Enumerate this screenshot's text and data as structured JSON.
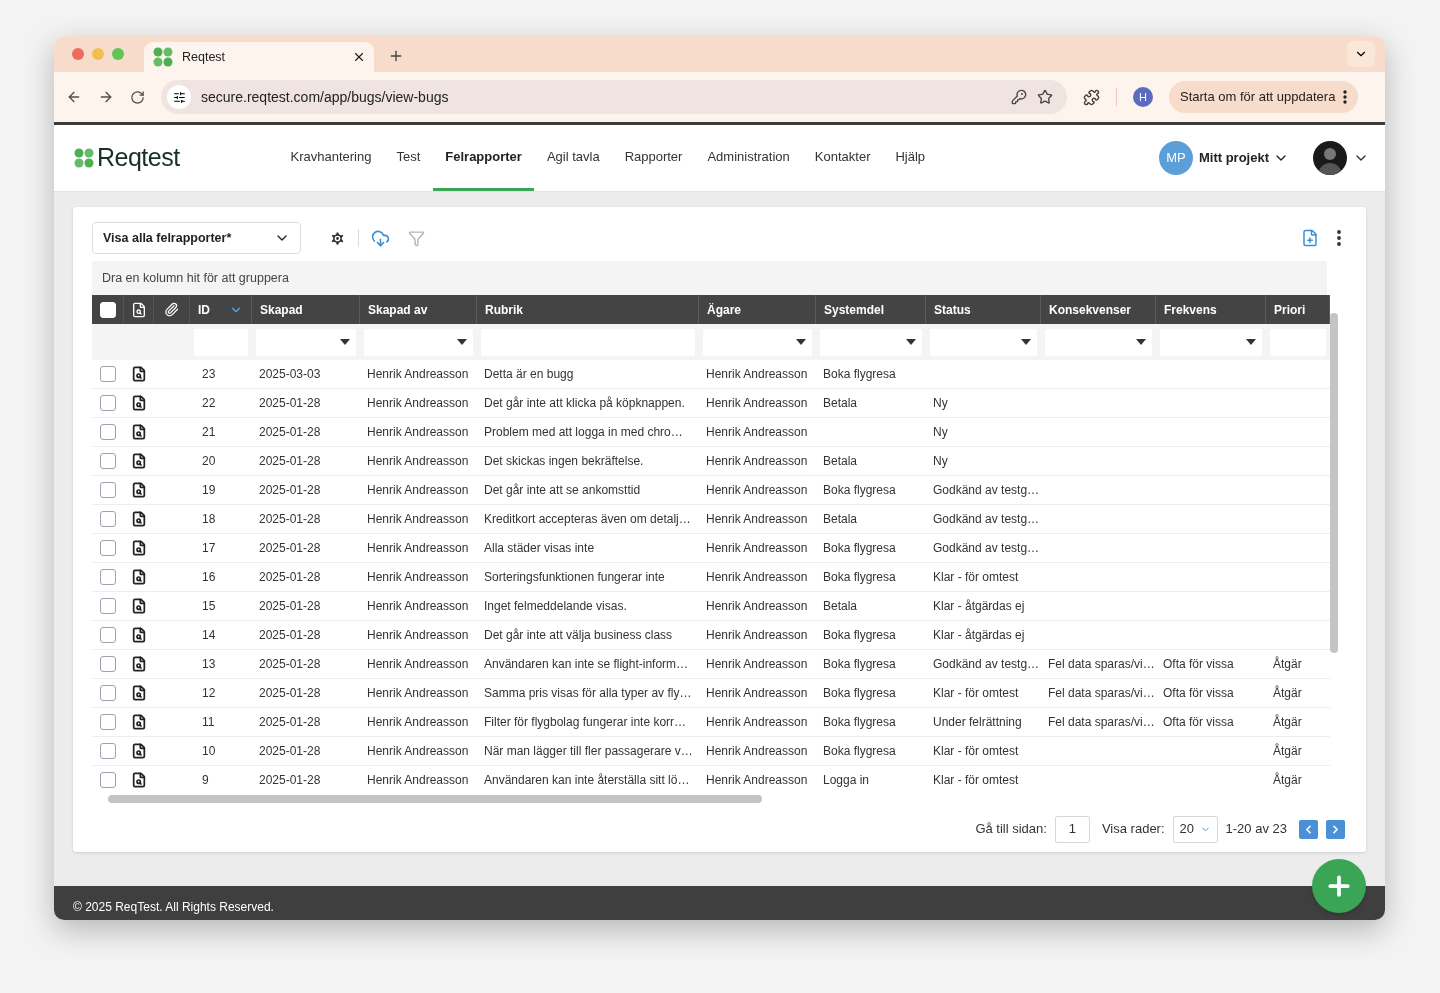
{
  "browser": {
    "tab_title": "Reqtest",
    "url": "secure.reqtest.com/app/bugs/view-bugs",
    "profile_initial": "H",
    "update_button": "Starta om för att uppdatera"
  },
  "app": {
    "logo": "Reqtest",
    "nav": [
      {
        "label": "Kravhantering",
        "selected": false
      },
      {
        "label": "Test",
        "selected": false
      },
      {
        "label": "Felrapporter",
        "selected": true
      },
      {
        "label": "Agil tavla",
        "selected": false
      },
      {
        "label": "Rapporter",
        "selected": false
      },
      {
        "label": "Administration",
        "selected": false
      },
      {
        "label": "Kontakter",
        "selected": false
      },
      {
        "label": "Hjälp",
        "selected": false
      }
    ],
    "project": {
      "initials": "MP",
      "name": "Mitt projekt"
    }
  },
  "toolbar": {
    "view_select": "Visa alla felrapporter*"
  },
  "group_hint": "Dra en kolumn hit för att gruppera",
  "table": {
    "select_all": {
      "checked": false
    },
    "columns": [
      {
        "label": "ID",
        "kind": "text",
        "sorted": true
      },
      {
        "label": "Skapad",
        "kind": "select",
        "sorted": false
      },
      {
        "label": "Skapad av",
        "kind": "select",
        "sorted": false
      },
      {
        "label": "Rubrik",
        "kind": "text",
        "sorted": false
      },
      {
        "label": "Ägare",
        "kind": "select",
        "sorted": false
      },
      {
        "label": "Systemdel",
        "kind": "select",
        "sorted": false
      },
      {
        "label": "Status",
        "kind": "select",
        "sorted": false
      },
      {
        "label": "Konsekvenser",
        "kind": "select",
        "sorted": false
      },
      {
        "label": "Frekvens",
        "kind": "select",
        "sorted": false
      },
      {
        "label": "Priori",
        "kind": "text",
        "sorted": false
      }
    ],
    "rows": [
      {
        "checked": false,
        "cells": [
          "23",
          "2025-03-03",
          "Henrik Andreasson",
          "Detta är en bugg",
          "Henrik Andreasson",
          "Boka flygresa",
          null,
          null,
          null,
          null
        ]
      },
      {
        "checked": false,
        "cells": [
          "22",
          "2025-01-28",
          "Henrik Andreasson",
          "Det går inte att klicka på köpknappen.",
          "Henrik Andreasson",
          "Betala",
          "Ny",
          null,
          null,
          null
        ]
      },
      {
        "checked": false,
        "cells": [
          "21",
          "2025-01-28",
          "Henrik Andreasson",
          "Problem med att logga in med chro…",
          "Henrik Andreasson",
          null,
          "Ny",
          null,
          null,
          null
        ]
      },
      {
        "checked": false,
        "cells": [
          "20",
          "2025-01-28",
          "Henrik Andreasson",
          "Det skickas ingen bekräftelse.",
          "Henrik Andreasson",
          "Betala",
          "Ny",
          null,
          null,
          null
        ]
      },
      {
        "checked": false,
        "cells": [
          "19",
          "2025-01-28",
          "Henrik Andreasson",
          "Det går inte att se ankomsttid",
          "Henrik Andreasson",
          "Boka flygresa",
          "Godkänd av testg…",
          null,
          null,
          null
        ]
      },
      {
        "checked": false,
        "cells": [
          "18",
          "2025-01-28",
          "Henrik Andreasson",
          "Kreditkort accepteras även om detalj…",
          "Henrik Andreasson",
          "Betala",
          "Godkänd av testg…",
          null,
          null,
          null
        ]
      },
      {
        "checked": false,
        "cells": [
          "17",
          "2025-01-28",
          "Henrik Andreasson",
          "Alla städer visas inte",
          "Henrik Andreasson",
          "Boka flygresa",
          "Godkänd av testg…",
          null,
          null,
          null
        ]
      },
      {
        "checked": false,
        "cells": [
          "16",
          "2025-01-28",
          "Henrik Andreasson",
          "Sorteringsfunktionen fungerar inte",
          "Henrik Andreasson",
          "Boka flygresa",
          "Klar - för omtest",
          null,
          null,
          null
        ]
      },
      {
        "checked": false,
        "cells": [
          "15",
          "2025-01-28",
          "Henrik Andreasson",
          "Inget felmeddelande visas.",
          "Henrik Andreasson",
          "Betala",
          "Klar - åtgärdas ej",
          null,
          null,
          null
        ]
      },
      {
        "checked": false,
        "cells": [
          "14",
          "2025-01-28",
          "Henrik Andreasson",
          "Det går inte att välja business class",
          "Henrik Andreasson",
          "Boka flygresa",
          "Klar - åtgärdas ej",
          null,
          null,
          null
        ]
      },
      {
        "checked": false,
        "cells": [
          "13",
          "2025-01-28",
          "Henrik Andreasson",
          "Användaren kan inte se flight-inform…",
          "Henrik Andreasson",
          "Boka flygresa",
          "Godkänd av testg…",
          "Fel data sparas/vi…",
          "Ofta för vissa",
          "Åtgär"
        ]
      },
      {
        "checked": false,
        "cells": [
          "12",
          "2025-01-28",
          "Henrik Andreasson",
          "Samma pris visas för alla typer av fly…",
          "Henrik Andreasson",
          "Boka flygresa",
          "Klar - för omtest",
          "Fel data sparas/vi…",
          "Ofta för vissa",
          "Åtgär"
        ]
      },
      {
        "checked": false,
        "cells": [
          "11",
          "2025-01-28",
          "Henrik Andreasson",
          "Filter för flygbolag fungerar inte korr…",
          "Henrik Andreasson",
          "Boka flygresa",
          "Under felrättning",
          "Fel data sparas/vi…",
          "Ofta för vissa",
          "Åtgär"
        ]
      },
      {
        "checked": false,
        "cells": [
          "10",
          "2025-01-28",
          "Henrik Andreasson",
          "När man lägger till fler passagerare v…",
          "Henrik Andreasson",
          "Boka flygresa",
          "Klar - för omtest",
          null,
          null,
          "Åtgär"
        ]
      },
      {
        "checked": false,
        "cells": [
          "9",
          "2025-01-28",
          "Henrik Andreasson",
          "Användaren kan inte återställa sitt lö…",
          "Henrik Andreasson",
          "Logga in",
          "Klar - för omtest",
          null,
          null,
          "Åtgär"
        ]
      }
    ]
  },
  "pagination": {
    "goto_label": "Gå till sidan:",
    "page": "1",
    "rows_label": "Visa rader:",
    "rows_per_page": "20",
    "range": "1-20 av 23"
  },
  "footer": "© 2025 ReqTest. All Rights Reserved."
}
